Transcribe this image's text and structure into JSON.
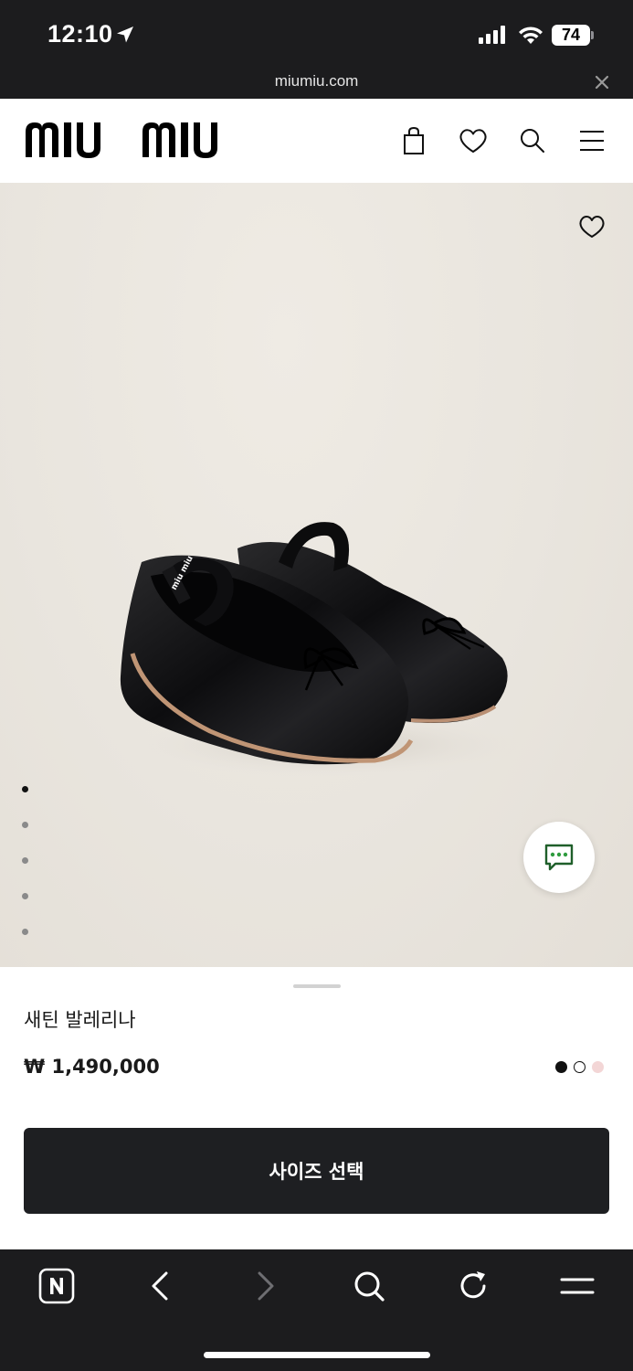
{
  "status_bar": {
    "time": "12:10",
    "battery": "74"
  },
  "browser": {
    "url": "miumiu.com"
  },
  "header": {
    "logo_text": "miu miu",
    "icons": [
      "bag-icon",
      "heart-icon",
      "search-icon",
      "menu-icon"
    ]
  },
  "hero": {
    "image_description_icon": "ballerina-shoe-image",
    "gallery_count": 5,
    "gallery_active_index": 0
  },
  "product": {
    "name": "새틴 발레리나",
    "price": "₩ 1,490,000",
    "colors": [
      "#111111",
      "#ffffff",
      "#f3d6d6"
    ],
    "selected_color_index": 0
  },
  "cta": {
    "label": "사이즈 선택"
  },
  "toolbar": {
    "icons": [
      "naver-home-icon",
      "back-icon",
      "forward-icon",
      "search-icon",
      "reload-icon",
      "menu-icon"
    ]
  },
  "colors": {
    "dark": "#1c1c1e",
    "hero_bg": "#e9e5de",
    "cta_bg": "#1e1f22",
    "chat_icon": "#2e7d32"
  }
}
